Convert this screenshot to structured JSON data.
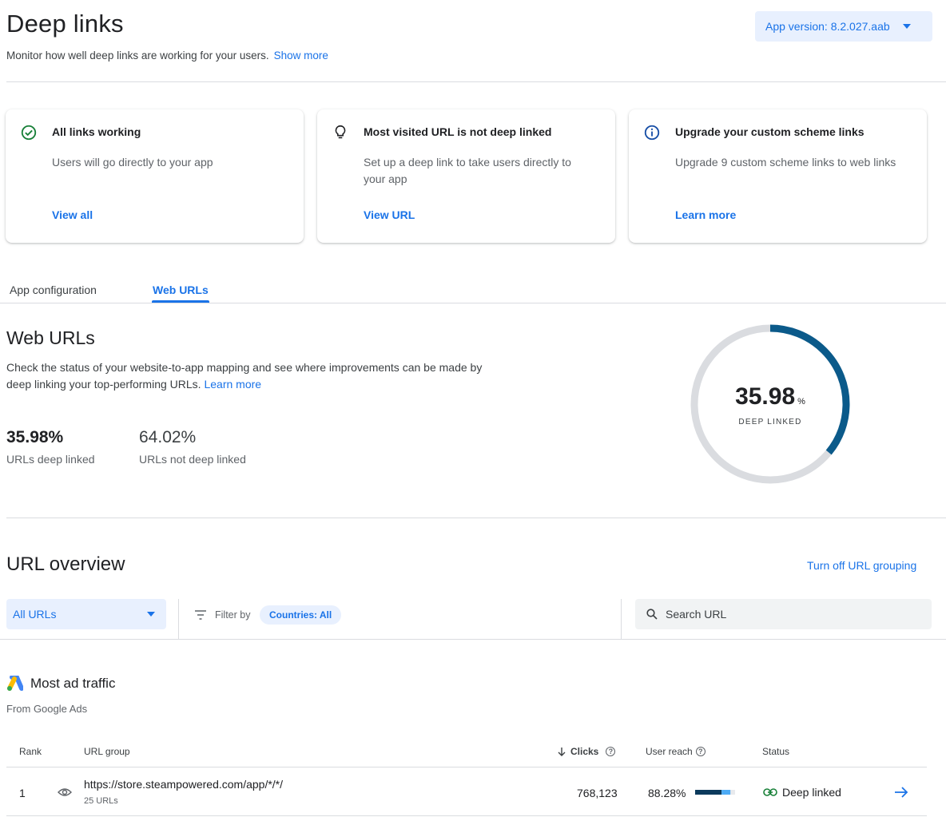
{
  "header": {
    "title": "Deep links",
    "subtitle": "Monitor how well deep links are working for your users.",
    "show_more": "Show more",
    "version_button": "App version: 8.2.027.aab"
  },
  "cards": [
    {
      "icon": "check-circle-icon",
      "title": "All links working",
      "body": "Users will go directly to your app",
      "link": "View all"
    },
    {
      "icon": "lightbulb-icon",
      "title": "Most visited URL is not deep linked",
      "body": "Set up a deep link to take users directly to your app",
      "link": "View URL"
    },
    {
      "icon": "info-icon",
      "title": "Upgrade your custom scheme links",
      "body": "Upgrade 9 custom scheme links to web links",
      "link": "Learn more"
    }
  ],
  "tabs": [
    {
      "label": "App configuration",
      "selected": false
    },
    {
      "label": "Web URLs",
      "selected": true
    }
  ],
  "web_urls": {
    "title": "Web URLs",
    "description": "Check the status of your website-to-app mapping and see where improvements can be made by deep linking your top-performing URLs.",
    "learn_more": "Learn more",
    "deep_linked_value": "35.98%",
    "deep_linked_label": "URLs deep linked",
    "not_deep_linked_value": "64.02%",
    "not_deep_linked_label": "URLs not deep linked",
    "donut": {
      "value": "35.98",
      "percent_sign": "%",
      "label": "DEEP LINKED",
      "fraction": 0.3598,
      "fill_color": "#0b5a8a",
      "track_color": "#dadce0"
    }
  },
  "overview": {
    "title": "URL overview",
    "grouping_link": "Turn off URL grouping",
    "filter_select": "All URLs",
    "filter_label": "Filter by",
    "country_chip": "Countries: All",
    "search_placeholder": "Search URL"
  },
  "section": {
    "title": "Most ad traffic",
    "subtitle": "From Google Ads"
  },
  "table": {
    "headers": {
      "rank": "Rank",
      "url_group": "URL group",
      "clicks": "Clicks",
      "user_reach": "User reach",
      "status": "Status"
    },
    "rows": [
      {
        "rank": "1",
        "url": "https://store.steampowered.com/app/*/*/",
        "count": "25 URLs",
        "clicks": "768,123",
        "reach": "88.28%",
        "reach_fraction": 0.8828,
        "status": "Deep linked"
      }
    ]
  },
  "colors": {
    "accent": "#1a73e8",
    "status_ok": "#188038",
    "reach_dark": "#0b3a5c",
    "reach_light": "#4dabf5"
  }
}
